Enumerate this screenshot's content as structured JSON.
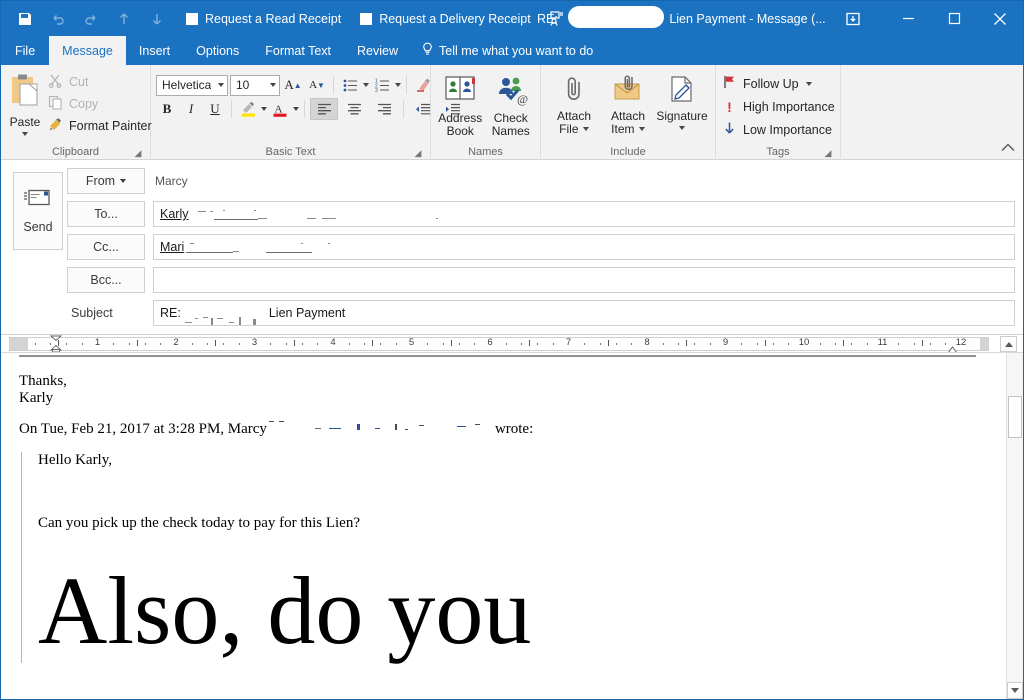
{
  "window": {
    "title_prefix": "RE:",
    "title_suffix": "Lien Payment  -  Message (...",
    "accent_color": "#1b72c0"
  },
  "quick_access": {
    "save_icon": "save-icon",
    "undo_icon": "undo-icon",
    "redo_icon": "redo-icon",
    "up_icon": "previous-item-icon",
    "down_icon": "next-item-icon",
    "read_receipt_label": "Request a Read Receipt",
    "delivery_receipt_label": "Request a Delivery Receipt",
    "check_names_icon": "check-names-icon",
    "customize_icon": "customize-quick-access-toolbar-icon"
  },
  "window_controls": {
    "ribbon_display_options": "ribbon-display-options-icon",
    "minimize": "minimize-icon",
    "maximize": "maximize-icon",
    "close": "close-icon"
  },
  "tabs": [
    {
      "label": "File",
      "active": false
    },
    {
      "label": "Message",
      "active": true
    },
    {
      "label": "Insert",
      "active": false
    },
    {
      "label": "Options",
      "active": false
    },
    {
      "label": "Format Text",
      "active": false
    },
    {
      "label": "Review",
      "active": false
    }
  ],
  "tell_me": {
    "label": "Tell me what you want to do",
    "icon": "lightbulb-icon"
  },
  "ribbon": {
    "clipboard": {
      "group_label": "Clipboard",
      "paste_label": "Paste",
      "cut_label": "Cut",
      "copy_label": "Copy",
      "format_painter_label": "Format Painter"
    },
    "basic_text": {
      "group_label": "Basic Text",
      "font_name": "Helvetica",
      "font_size": "10",
      "grow_font": "A",
      "shrink_font": "A",
      "bold": "B",
      "italic": "I",
      "underline": "U"
    },
    "names": {
      "group_label": "Names",
      "address_book_line1": "Address",
      "address_book_line2": "Book",
      "check_names_line1": "Check",
      "check_names_line2": "Names"
    },
    "include": {
      "group_label": "Include",
      "attach_file_line1": "Attach",
      "attach_file_line2": "File",
      "attach_item_line1": "Attach",
      "attach_item_line2": "Item",
      "signature_line1": "Signature"
    },
    "tags": {
      "group_label": "Tags",
      "follow_up_label": "Follow Up",
      "high_importance_label": "High Importance",
      "low_importance_label": "Low Importance",
      "follow_up_color": "#c0392b",
      "high_importance_color": "#d13438",
      "low_importance_color": "#2b579a"
    },
    "collapse_label": "Collapse the Ribbon"
  },
  "compose": {
    "send_label": "Send",
    "from_label": "From",
    "from_value": "Marcy",
    "to_label": "To...",
    "to_value": "Karly",
    "cc_label": "Cc...",
    "cc_value": "Mari",
    "bcc_label": "Bcc...",
    "bcc_value": "",
    "subject_label": "Subject",
    "subject_prefix": "RE:",
    "subject_suffix": "Lien Payment"
  },
  "ruler": {
    "numbers": [
      "1",
      "2",
      "3",
      "4",
      "5",
      "6",
      "7",
      "8",
      "9",
      "10",
      "11",
      "12"
    ]
  },
  "body": {
    "signoff_line1": "Thanks,",
    "signoff_line2": "Karly",
    "reply_header_prefix": "On Tue, Feb 21, 2017 at 3:28 PM, Marcy",
    "reply_header_suffix": "wrote:",
    "quoted_greeting": "Hello Karly,",
    "quoted_question": "Can you pick up the check today to pay for this Lien?",
    "large_text": "Also, do you"
  },
  "scrollbar": {
    "up_arrow": "scroll-up-icon",
    "down_arrow": "scroll-down-icon"
  }
}
